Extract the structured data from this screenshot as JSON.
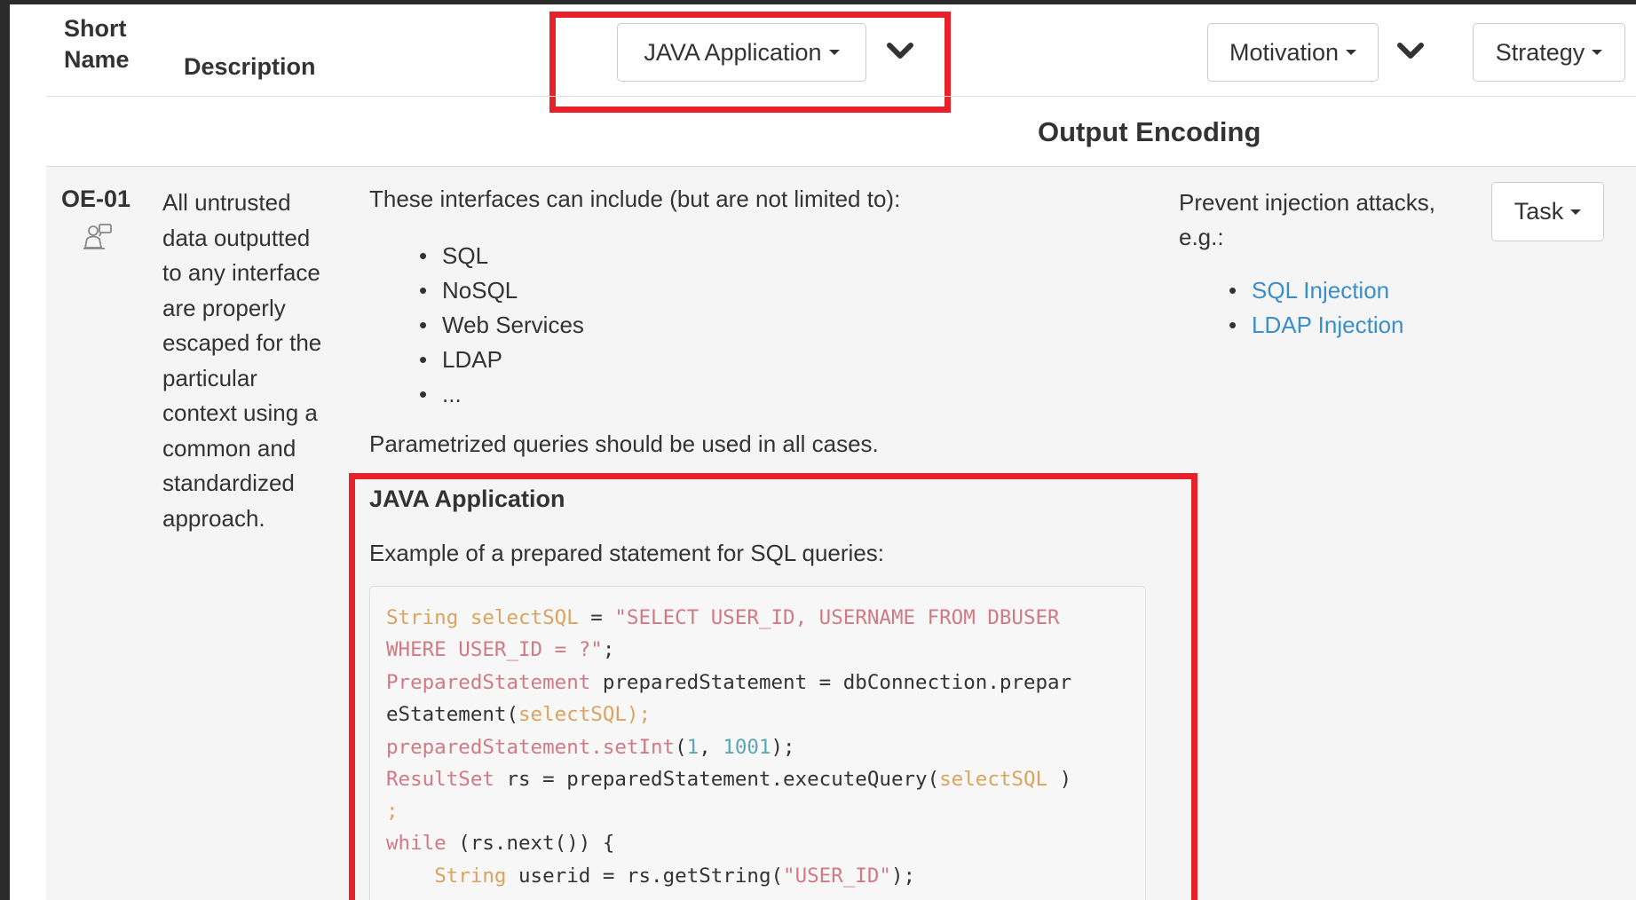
{
  "header": {
    "col_short_name": [
      "Short",
      "Name"
    ],
    "col_description": "Description",
    "app_dropdown_label": "JAVA Application",
    "motivation_dropdown_label": "Motivation",
    "strategy_dropdown_label": "Strategy"
  },
  "section": {
    "title": "Output Encoding"
  },
  "row": {
    "short_name": "OE-01",
    "description_lines": [
      "All untrusted",
      "data outputted",
      "to any interface",
      "are properly",
      "escaped for the",
      "particular",
      "context using a",
      "common and",
      "standardized",
      "approach."
    ],
    "intro": "These interfaces can include (but are not limited to):",
    "interfaces": [
      "SQL",
      "NoSQL",
      "Web Services",
      "LDAP",
      "..."
    ],
    "parametrized_note": "Parametrized queries should be used in all cases.",
    "motivation_text_lines": [
      "Prevent injection attacks,",
      "e.g.:"
    ],
    "motivation_links": [
      "SQL Injection",
      "LDAP Injection"
    ],
    "task_label": "Task",
    "java_title": "JAVA Application",
    "java_example": "Example of a prepared statement for SQL queries:",
    "code": {
      "l1_type": "String",
      "l1_var": " selectSQL",
      "l1_op": " = ",
      "l1_str": "\"SELECT USER_ID, USERNAME FROM DBUSER",
      "l2_str": "WHERE USER_ID = ?\"",
      "l2_end": ";",
      "l3_type": "PreparedStatement",
      "l3_rest": " preparedStatement = dbConnection.prepar",
      "l4_a": "eStatement(",
      "l4_arg": "selectSQL);",
      "l5_call": "preparedStatement.setInt",
      "l5_open": "(",
      "l5_n1": "1",
      "l5_sep": ", ",
      "l5_n2": "1001",
      "l5_close": ");",
      "l6_type": "ResultSet",
      "l6_rest": " rs = preparedStatement.executeQuery(",
      "l6_arg": "selectSQL",
      "l6_close": " )",
      "l7": ";",
      "l8_kw": "while",
      "l8_rest": " (rs.next()) {",
      "l9_indent": "    ",
      "l9_type": "String",
      "l9_rest": " userid = rs.getString(",
      "l9_str": "\"USER_ID\"",
      "l9_close": ");"
    }
  },
  "colors": {
    "highlight": "#e8202a",
    "link": "#3a8fc9"
  }
}
